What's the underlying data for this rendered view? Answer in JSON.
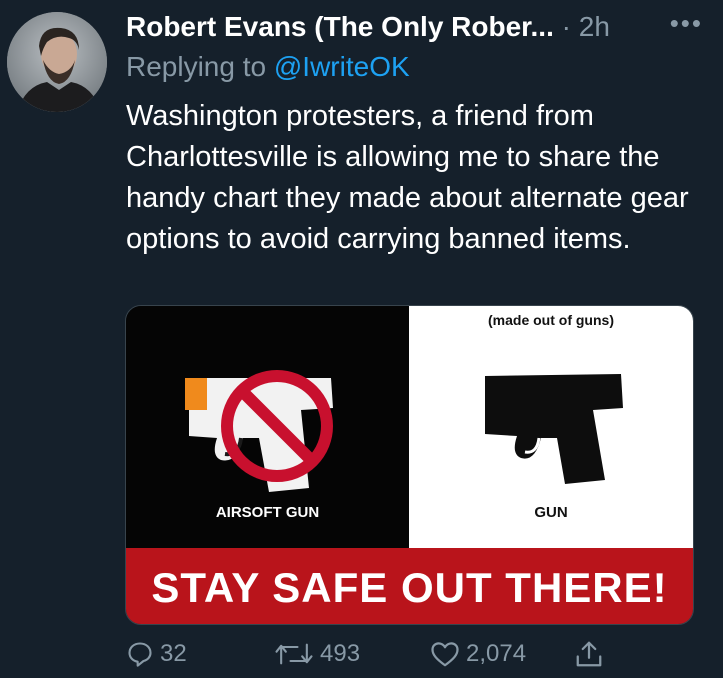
{
  "tweet": {
    "author_name": "Robert Evans (The Only Rober...",
    "separator": "·",
    "time": "2h",
    "more_label": "•••",
    "reply_prefix": "Replying to",
    "reply_handle": "@IwriteOK",
    "text": "Washington protesters, a friend from Charlottesville is allowing me to share the handy chart they made about alternate gear options to avoid carrying banned items."
  },
  "media": {
    "caption_top": "(made out of guns)",
    "label_left": "AIRSOFT GUN",
    "label_right": "GUN",
    "banner": "STAY SAFE OUT THERE!"
  },
  "actions": {
    "reply_count": "32",
    "retweet_count": "493",
    "like_count": "2,074"
  },
  "colors": {
    "background": "#15202b",
    "secondary_text": "#8899a6",
    "link": "#1da1f2",
    "banner_red": "#b9141b",
    "prohibited_red": "#c8102e"
  },
  "icons": [
    "avatar",
    "more-icon",
    "airsoft-gun-icon",
    "prohibited-icon",
    "gun-icon",
    "reply-icon",
    "retweet-icon",
    "like-icon",
    "share-icon"
  ]
}
